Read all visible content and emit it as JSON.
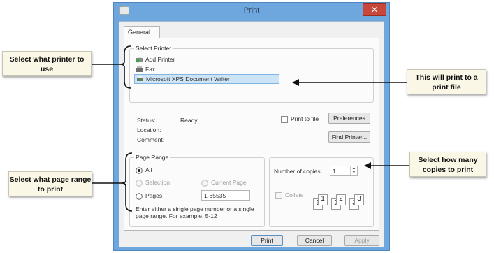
{
  "window": {
    "title": "Print",
    "close_glyph": "✕"
  },
  "tabs": [
    {
      "label": "General"
    }
  ],
  "select_printer": {
    "group_title": "Select Printer",
    "printers": [
      {
        "label": "Add Printer",
        "icon": "add-printer-icon"
      },
      {
        "label": "Fax",
        "icon": "fax-icon"
      },
      {
        "label": "Microsoft XPS Document Writer",
        "icon": "printer-icon",
        "selected": true
      }
    ],
    "status_label": "Status:",
    "status_value": "Ready",
    "location_label": "Location:",
    "comment_label": "Comment:",
    "print_to_file_label": "Print to file",
    "preferences_button": "Preferences",
    "find_printer_button": "Find Printer..."
  },
  "page_range": {
    "group_title": "Page Range",
    "all_label": "All",
    "selection_label": "Selection",
    "current_page_label": "Current Page",
    "pages_label": "Pages",
    "pages_value": "1-65535",
    "hint": "Enter either a single page number or a single page range.  For example, 5-12"
  },
  "copies": {
    "number_label": "Number of copies:",
    "number_value": "1",
    "collate_label": "Collate",
    "collate_pages": [
      "1",
      "1",
      "2",
      "2",
      "3",
      "3"
    ]
  },
  "buttons": {
    "print": "Print",
    "cancel": "Cancel",
    "apply": "Apply"
  },
  "callouts": {
    "printer": "Select what printer to use",
    "page_range": "Select what page range to print",
    "print_file": "This will print to a print file",
    "copies": "Select how many copies to print"
  },
  "colors": {
    "titlebar": "#6ea7dd",
    "close": "#c7473a",
    "selection": "#cde4f7",
    "callout_bg": "#fbf7e7"
  }
}
